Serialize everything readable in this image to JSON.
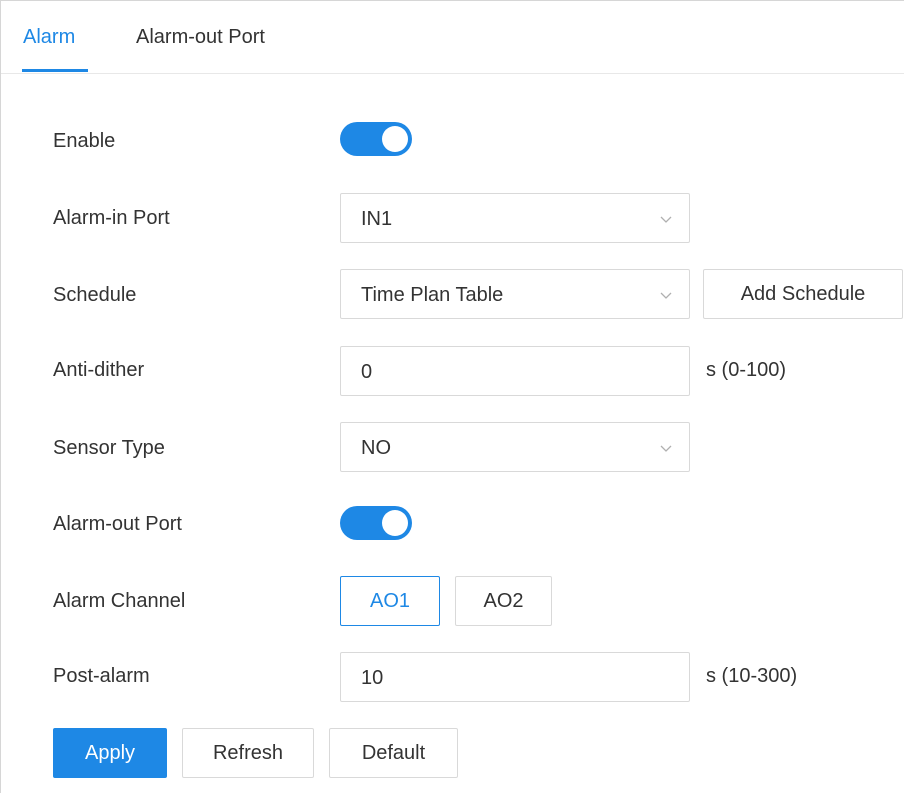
{
  "tabs": [
    {
      "label": "Alarm",
      "active": true
    },
    {
      "label": "Alarm-out Port",
      "active": false
    }
  ],
  "form": {
    "enable": {
      "label": "Enable",
      "on": true
    },
    "alarm_in_port": {
      "label": "Alarm-in Port",
      "value": "IN1"
    },
    "schedule": {
      "label": "Schedule",
      "value": "Time Plan Table",
      "add_button": "Add Schedule"
    },
    "anti_dither": {
      "label": "Anti-dither",
      "value": "0",
      "unit": "s (0-100)"
    },
    "sensor_type": {
      "label": "Sensor Type",
      "value": "NO"
    },
    "alarm_out_port": {
      "label": "Alarm-out Port",
      "on": true
    },
    "alarm_channel": {
      "label": "Alarm Channel",
      "options": [
        "AO1",
        "AO2"
      ],
      "selected": "AO1"
    },
    "post_alarm": {
      "label": "Post-alarm",
      "value": "10",
      "unit": "s (10-300)"
    }
  },
  "actions": {
    "apply": "Apply",
    "refresh": "Refresh",
    "default": "Default"
  },
  "colors": {
    "accent": "#1e88e5",
    "border": "#d9d9d9",
    "text": "#333333"
  }
}
